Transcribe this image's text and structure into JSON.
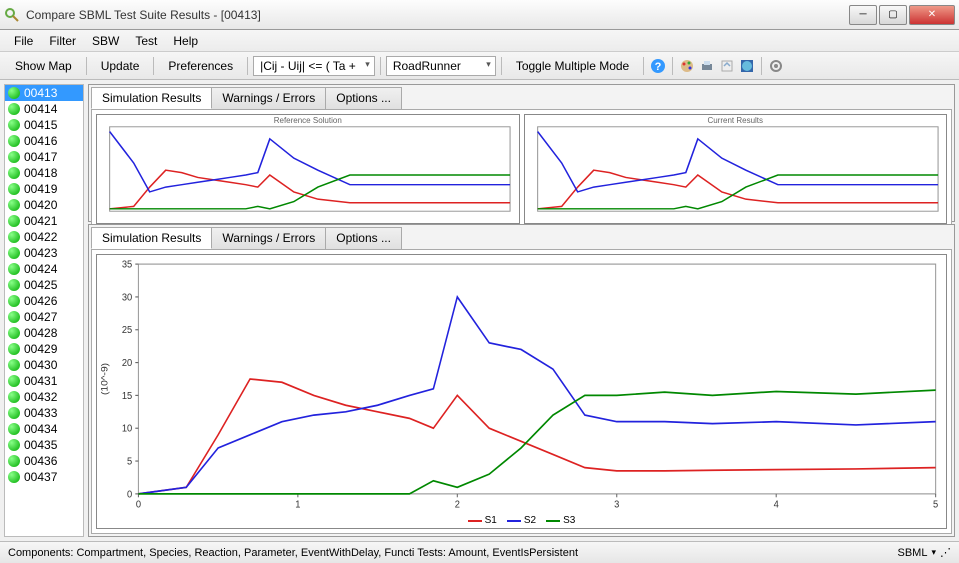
{
  "window": {
    "title": "Compare SBML Test Suite Results   -   [00413]"
  },
  "menu": [
    "File",
    "Filter",
    "SBW",
    "Test",
    "Help"
  ],
  "toolbar": {
    "show_map": "Show Map",
    "update": "Update",
    "preferences": "Preferences",
    "formula": "|Cij - Uij| <= ( Ta +",
    "simulator": "RoadRunner",
    "toggle": "Toggle Multiple Mode"
  },
  "sidebar": {
    "items": [
      "00413",
      "00414",
      "00415",
      "00416",
      "00417",
      "00418",
      "00419",
      "00420",
      "00421",
      "00422",
      "00423",
      "00424",
      "00425",
      "00426",
      "00427",
      "00428",
      "00429",
      "00430",
      "00431",
      "00432",
      "00433",
      "00434",
      "00435",
      "00436",
      "00437"
    ],
    "selected": "00413"
  },
  "tabs": [
    "Simulation Results",
    "Warnings / Errors",
    "Options ..."
  ],
  "small_titles": {
    "left": "Reference Solution",
    "right": "Current Results"
  },
  "y_axis_label": "(10^-9)",
  "status": {
    "left": "Components: Compartment, Species, Reaction, Parameter, EventWithDelay, Functi Tests: Amount, EventIsPersistent",
    "right": "SBML"
  },
  "chart_data": [
    {
      "type": "line",
      "title": "Reference Solution",
      "xlim": [
        0,
        5
      ],
      "ylim": [
        0,
        35
      ],
      "series": [
        {
          "name": "S1",
          "color": "#d22",
          "x": [
            0,
            0.3,
            0.5,
            0.7,
            0.9,
            1.1,
            1.3,
            1.5,
            1.7,
            1.85,
            2.0,
            2.3,
            2.6,
            3.0,
            3.5,
            4.0,
            4.5,
            5.0
          ],
          "values": [
            1,
            2,
            10,
            17,
            16,
            14,
            13,
            12,
            11,
            10,
            15,
            8,
            5,
            3.5,
            3.5,
            3.5,
            3.5,
            3.5
          ]
        },
        {
          "name": "S2",
          "color": "#22d",
          "x": [
            0,
            0.3,
            0.5,
            0.7,
            0.9,
            1.1,
            1.3,
            1.5,
            1.7,
            1.85,
            2.0,
            2.3,
            2.6,
            3.0,
            3.5,
            4.0,
            4.5,
            5.0
          ],
          "values": [
            33,
            20,
            8,
            10,
            11,
            12,
            13,
            14,
            15,
            16,
            30,
            22,
            17,
            11,
            11,
            11,
            11,
            11
          ]
        },
        {
          "name": "S3",
          "color": "#080",
          "x": [
            0,
            0.3,
            0.5,
            0.7,
            0.9,
            1.1,
            1.3,
            1.5,
            1.7,
            1.85,
            2.0,
            2.3,
            2.6,
            3.0,
            3.5,
            4.0,
            4.5,
            5.0
          ],
          "values": [
            1,
            1,
            1,
            1,
            1,
            1,
            1,
            1,
            1,
            2,
            1,
            4,
            10,
            15,
            15,
            15,
            15,
            15
          ]
        }
      ]
    },
    {
      "type": "line",
      "title": "Current Results",
      "xlim": [
        0,
        5
      ],
      "ylim": [
        0,
        35
      ],
      "series": [
        {
          "name": "S1",
          "color": "#d22",
          "x": [
            0,
            0.3,
            0.5,
            0.7,
            0.9,
            1.1,
            1.3,
            1.5,
            1.7,
            1.85,
            2.0,
            2.3,
            2.6,
            3.0,
            3.5,
            4.0,
            4.5,
            5.0
          ],
          "values": [
            1,
            2,
            10,
            17,
            16,
            14,
            13,
            12,
            11,
            10,
            15,
            8,
            5,
            3.5,
            3.5,
            3.5,
            3.5,
            3.5
          ]
        },
        {
          "name": "S2",
          "color": "#22d",
          "x": [
            0,
            0.3,
            0.5,
            0.7,
            0.9,
            1.1,
            1.3,
            1.5,
            1.7,
            1.85,
            2.0,
            2.3,
            2.6,
            3.0,
            3.5,
            4.0,
            4.5,
            5.0
          ],
          "values": [
            33,
            20,
            8,
            10,
            11,
            12,
            13,
            14,
            15,
            16,
            30,
            22,
            17,
            11,
            11,
            11,
            11,
            11
          ]
        },
        {
          "name": "S3",
          "color": "#080",
          "x": [
            0,
            0.3,
            0.5,
            0.7,
            0.9,
            1.1,
            1.3,
            1.5,
            1.7,
            1.85,
            2.0,
            2.3,
            2.6,
            3.0,
            3.5,
            4.0,
            4.5,
            5.0
          ],
          "values": [
            1,
            1,
            1,
            1,
            1,
            1,
            1,
            1,
            1,
            2,
            1,
            4,
            10,
            15,
            15,
            15,
            15,
            15
          ]
        }
      ]
    },
    {
      "type": "line",
      "title": "Simulation Results",
      "xlabel": "",
      "ylabel": "(10^-9)",
      "xlim": [
        0,
        5
      ],
      "ylim": [
        0,
        35
      ],
      "x_ticks": [
        0,
        1,
        2,
        3,
        4,
        5
      ],
      "y_ticks": [
        0,
        5,
        10,
        15,
        20,
        25,
        30,
        35
      ],
      "series": [
        {
          "name": "S1",
          "color": "#d22",
          "x": [
            0,
            0.3,
            0.5,
            0.7,
            0.9,
            1.1,
            1.3,
            1.5,
            1.7,
            1.85,
            2.0,
            2.2,
            2.4,
            2.6,
            2.8,
            3.0,
            3.3,
            3.6,
            4.0,
            4.5,
            5.0
          ],
          "values": [
            0,
            1,
            9,
            17.5,
            17,
            15,
            13.5,
            12.5,
            11.5,
            10,
            15,
            10,
            8,
            6,
            4,
            3.5,
            3.5,
            3.6,
            3.7,
            3.8,
            4.0
          ]
        },
        {
          "name": "S2",
          "color": "#22d",
          "x": [
            0,
            0.3,
            0.5,
            0.7,
            0.9,
            1.1,
            1.3,
            1.5,
            1.7,
            1.85,
            2.0,
            2.2,
            2.4,
            2.6,
            2.8,
            3.0,
            3.3,
            3.6,
            4.0,
            4.5,
            5.0
          ],
          "values": [
            0,
            1,
            7,
            9,
            11,
            12,
            12.5,
            13.5,
            15,
            16,
            30,
            23,
            22,
            19,
            12,
            11,
            11,
            10.7,
            11,
            10.5,
            11
          ]
        },
        {
          "name": "S3",
          "color": "#080",
          "x": [
            0,
            0.3,
            0.5,
            0.7,
            0.9,
            1.1,
            1.3,
            1.5,
            1.7,
            1.85,
            2.0,
            2.2,
            2.4,
            2.6,
            2.8,
            3.0,
            3.3,
            3.6,
            4.0,
            4.5,
            5.0
          ],
          "values": [
            0,
            0,
            0,
            0,
            0,
            0,
            0,
            0,
            0,
            2,
            1,
            3,
            7,
            12,
            15,
            15,
            15.5,
            15,
            15.6,
            15.2,
            15.8
          ]
        }
      ]
    }
  ]
}
